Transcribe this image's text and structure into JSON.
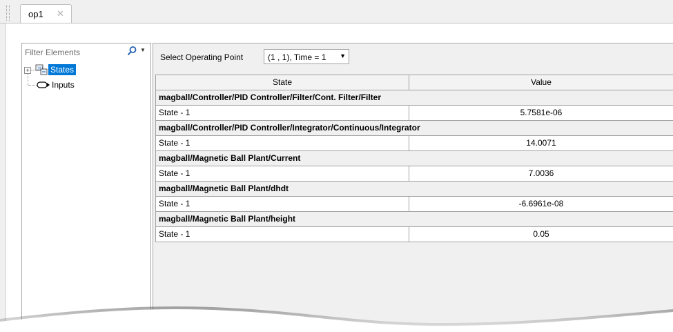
{
  "tabs": [
    {
      "label": "op1",
      "close_icon": "close-icon"
    }
  ],
  "filter": {
    "placeholder": "Filter Elements",
    "search_icon": "search-icon",
    "dropdown_icon": "chevron-down-icon"
  },
  "tree": {
    "items": [
      {
        "label": "States",
        "icon": "states-block-icon",
        "selected": true,
        "expandable": true
      },
      {
        "label": "Inputs",
        "icon": "input-port-icon",
        "selected": false,
        "expandable": false
      }
    ]
  },
  "operating_point": {
    "label": "Select Operating Point",
    "selected": "(1 , 1), Time = 1"
  },
  "table": {
    "headers": {
      "state": "State",
      "value": "Value"
    },
    "groups": [
      {
        "name": "magball/Controller/PID Controller/Filter/Cont. Filter/Filter",
        "rows": [
          {
            "state": "State - 1",
            "value": "5.7581e-06"
          }
        ]
      },
      {
        "name": "magball/Controller/PID Controller/Integrator/Continuous/Integrator",
        "rows": [
          {
            "state": "State - 1",
            "value": "14.0071"
          }
        ]
      },
      {
        "name": "magball/Magnetic Ball Plant/Current",
        "rows": [
          {
            "state": "State - 1",
            "value": "7.0036"
          }
        ]
      },
      {
        "name": "magball/Magnetic Ball Plant/dhdt",
        "rows": [
          {
            "state": "State - 1",
            "value": "-6.6961e-08"
          }
        ]
      },
      {
        "name": "magball/Magnetic Ball Plant/height",
        "rows": [
          {
            "state": "State - 1",
            "value": "0.05"
          }
        ]
      }
    ]
  },
  "colors": {
    "selection": "#0078d7",
    "grid": "#a0a0a0",
    "background": "#f0f0f0"
  }
}
